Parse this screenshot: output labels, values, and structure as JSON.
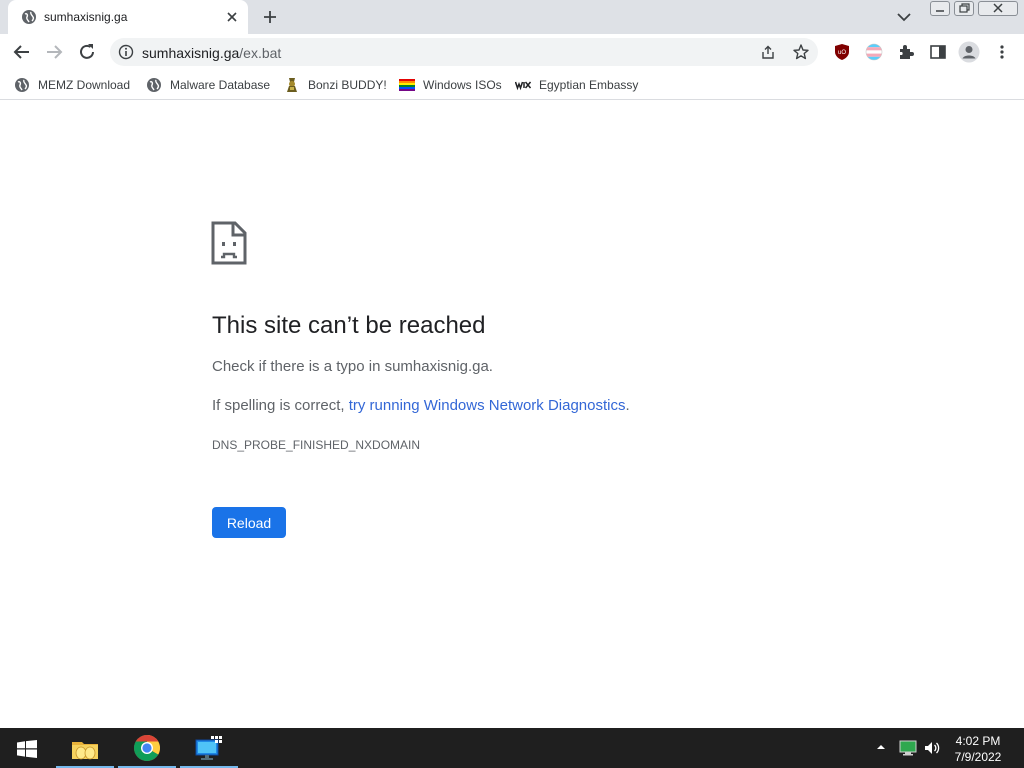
{
  "browser": {
    "tab": {
      "title": "sumhaxisnig.ga",
      "favicon": "globe-icon"
    },
    "url": {
      "host": "sumhaxisnig.ga",
      "path": "/ex.bat"
    },
    "bookmarks": [
      {
        "label": "MEMZ Download",
        "icon": "globe-icon"
      },
      {
        "label": "Malware Database",
        "icon": "globe-icon"
      },
      {
        "label": "Bonzi BUDDY!",
        "icon": "bonzi-icon"
      },
      {
        "label": "Windows ISOs",
        "icon": "rainbow-flag-icon"
      },
      {
        "label": "Egyptian Embassy",
        "icon": "wix-icon"
      }
    ],
    "extensions": [
      "ublock-icon",
      "trans-flag-icon",
      "puzzle-icon",
      "side-panel-icon",
      "profile-icon",
      "kebab-menu-icon"
    ]
  },
  "error_page": {
    "title": "This site can’t be reached",
    "line1": "Check if there is a typo in sumhaxisnig.ga.",
    "line2_prefix": "If spelling is correct, ",
    "line2_link": "try running Windows Network Diagnostics",
    "line2_suffix": ".",
    "error_code": "DNS_PROBE_FINISHED_NXDOMAIN",
    "reload_label": "Reload"
  },
  "taskbar": {
    "apps": [
      "file-explorer-icon",
      "chrome-icon",
      "network-app-icon"
    ],
    "time": "4:02 PM",
    "date": "7/9/2022"
  },
  "colors": {
    "accent": "#1a73e8",
    "link": "#3367d6",
    "tabstrip": "#dee1e6",
    "taskbar": "#1f1f1f"
  }
}
